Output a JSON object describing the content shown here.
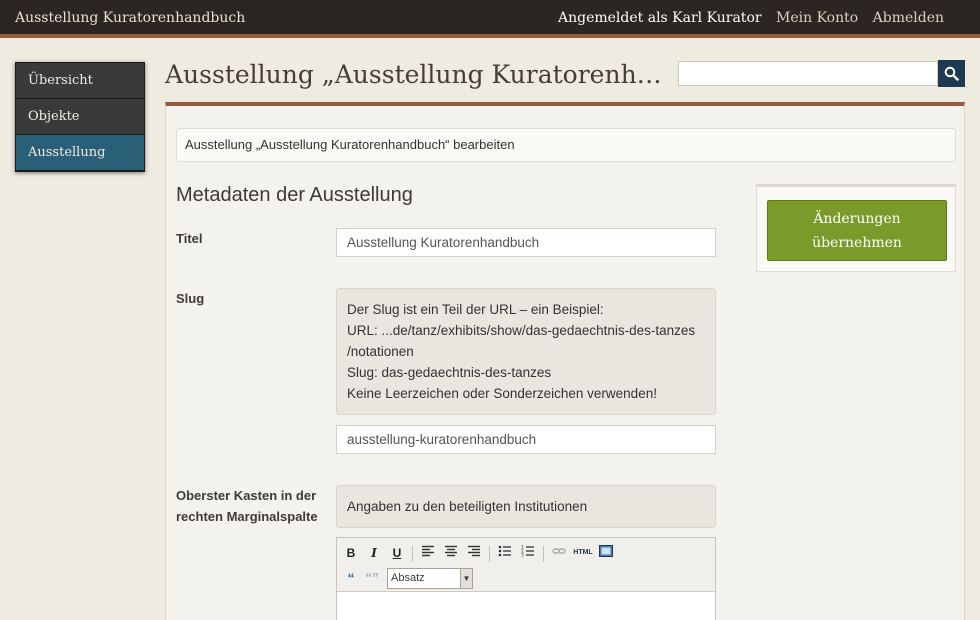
{
  "header": {
    "site_title": "Ausstellung Kuratorenhandbuch",
    "user_text": "Angemeldet als Karl Kurator",
    "account_link": "Mein Konto",
    "logout_link": "Abmelden"
  },
  "sidebar": {
    "items": [
      {
        "label": "Übersicht"
      },
      {
        "label": "Objekte"
      },
      {
        "label": "Ausstellung"
      }
    ]
  },
  "page": {
    "title": "Ausstellung „Ausstellung Kuratorenh…",
    "subtitle": "Ausstellung „Ausstellung Kuratorenhandbuch“ bearbeiten",
    "section_title": "Metadaten der Ausstellung"
  },
  "search": {
    "value": ""
  },
  "form": {
    "title_label": "Titel",
    "title_value": "Ausstellung Kuratorenhandbuch",
    "slug_label": "Slug",
    "slug_explanation": [
      "Der Slug ist ein Teil der URL – ein Beispiel:",
      "URL: ...de/tanz/exhibits/show/das-gedaechtnis-des-tanzes",
      "/notationen",
      "Slug: das-gedaechtnis-des-tanzes",
      "Keine Leerzeichen oder Sonderzeichen verwenden!"
    ],
    "slug_value": "ausstellung-kuratorenhandbuch",
    "top_box_label": "Oberster Kasten in der rechten Marginalspalte",
    "top_box_explanation": "Angaben zu den beteiligten Institutionen",
    "editor_format": "Absatz"
  },
  "actions": {
    "save_label": "Änderungen übernehmen"
  },
  "colors": {
    "accent_brown": "#9a5a3c",
    "active_sidebar": "#2a5f78",
    "save_green": "#7a9a2a",
    "search_button": "#1d3a52"
  }
}
